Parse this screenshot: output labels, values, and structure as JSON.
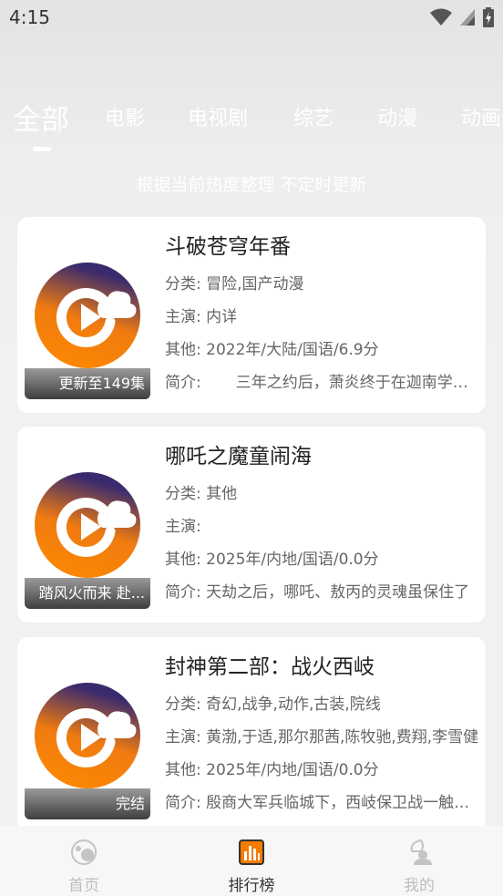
{
  "status_bar": {
    "time": "4:15"
  },
  "tabs": [
    {
      "label": "全部",
      "active": true
    },
    {
      "label": "电影"
    },
    {
      "label": "电视剧"
    },
    {
      "label": "综艺"
    },
    {
      "label": "动漫"
    },
    {
      "label": "动画"
    }
  ],
  "subtitle": "根据当前热度整理 不定时更新",
  "items": [
    {
      "title": "斗破苍穹年番",
      "category_label": "分类:",
      "category": "冒险,国产动漫",
      "cast_label": "主演:",
      "cast": "内详",
      "other_label": "其他:",
      "other": "2022年/大陆/国语/6.9分",
      "intro_label": "简介:",
      "intro": "三年之约后，萧炎终于在迦南学院见到了",
      "badge": "更新至149集"
    },
    {
      "title": "哪吒之魔童闹海",
      "category_label": "分类:",
      "category": "其他",
      "cast_label": "主演:",
      "cast": "",
      "other_label": "其他:",
      "other": "2025年/内地/国语/0.0分",
      "intro_label": "简介:",
      "intro": "天劫之后，哪吒、敖丙的灵魂虽保住了",
      "badge": "踏风火而来 赴..."
    },
    {
      "title": "封神第二部：战火西岐",
      "category_label": "分类:",
      "category": "奇幻,战争,动作,古装,院线",
      "cast_label": "主演:",
      "cast": "黄渤,于适,那尔那茜,陈牧驰,费翔,李雪健",
      "other_label": "其他:",
      "other": "2025年/内地/国语/0.0分",
      "intro_label": "简介:",
      "intro": "殷商大军兵临城下，西岐保卫战一触即发",
      "badge": "完结"
    }
  ],
  "bottom_nav": [
    {
      "label": "首页",
      "icon": "home-icon"
    },
    {
      "label": "排行榜",
      "icon": "ranking-icon",
      "active": true
    },
    {
      "label": "我的",
      "icon": "profile-icon"
    }
  ],
  "colors": {
    "accent_orange": "#f57c00",
    "logo_purple": "#3f2a6b",
    "nav_active": "#333333",
    "nav_inactive": "#bdbdbd"
  }
}
